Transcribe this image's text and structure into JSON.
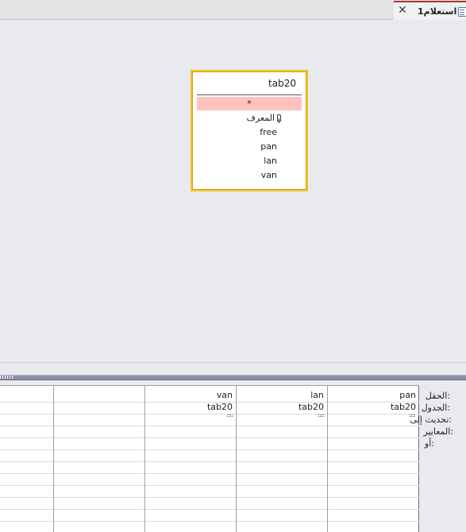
{
  "tab": {
    "title": "استعلام1",
    "close_glyph": "✕",
    "icon": "query-icon"
  },
  "table": {
    "name": "tab20",
    "fields": [
      "*",
      "المعرف",
      "free",
      "pan",
      "lan",
      "van"
    ]
  },
  "grid": {
    "row_labels": {
      "field": "الحقل:",
      "table": "الجدول:",
      "update_to": "تحديث إلى:",
      "criteria": "المعايير:",
      "or": "أو:"
    },
    "columns": [
      {
        "field": "pan",
        "table": "tab20"
      },
      {
        "field": "lan",
        "table": "tab20"
      },
      {
        "field": "van",
        "table": "tab20"
      },
      {
        "field": "",
        "table": ""
      },
      {
        "field": "",
        "table": ""
      }
    ]
  }
}
